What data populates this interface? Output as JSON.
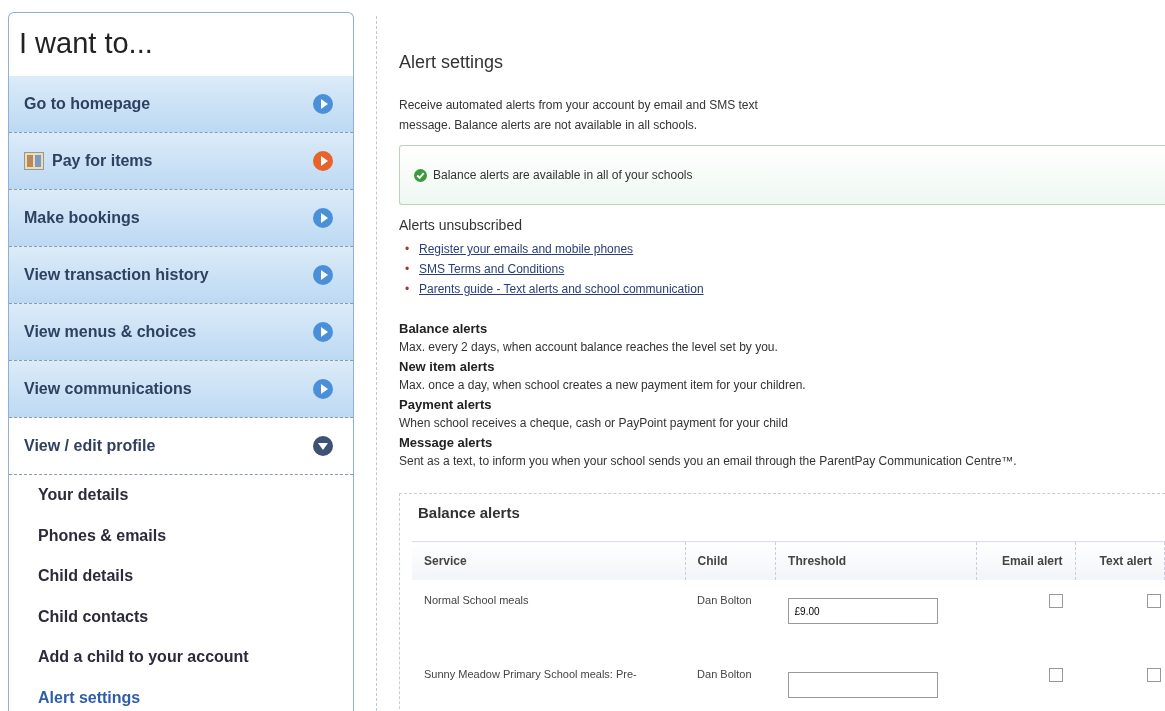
{
  "sidebar": {
    "title": "I want to...",
    "items": [
      {
        "label": "Go to homepage",
        "color": "#4a90d9",
        "has_image": false,
        "expanded": false
      },
      {
        "label": "Pay for items",
        "color": "#e8622c",
        "has_image": true,
        "expanded": false
      },
      {
        "label": "Make bookings",
        "color": "#4a90d9",
        "has_image": false,
        "expanded": false
      },
      {
        "label": "View transaction history",
        "color": "#4a90d9",
        "has_image": false,
        "expanded": false
      },
      {
        "label": "View menus & choices",
        "color": "#4a90d9",
        "has_image": false,
        "expanded": false
      },
      {
        "label": "View communications",
        "color": "#4a90d9",
        "has_image": false,
        "expanded": false
      },
      {
        "label": "View / edit profile",
        "color": "#3d5275",
        "has_image": false,
        "expanded": true,
        "children": [
          {
            "label": "Your details",
            "selected": false
          },
          {
            "label": "Phones & emails",
            "selected": false
          },
          {
            "label": "Child details",
            "selected": false
          },
          {
            "label": "Child contacts",
            "selected": false
          },
          {
            "label": "Add a child to your account",
            "selected": false
          },
          {
            "label": "Alert settings",
            "selected": true
          }
        ]
      }
    ]
  },
  "main": {
    "title": "Alert settings",
    "intro": "Receive automated alerts from your account by email and SMS text message. Balance alerts are not available in all schools.",
    "notice": "Balance alerts are available in all of your schools",
    "unsubscribed_heading": "Alerts unsubscribed",
    "links": [
      {
        "bullet": "•",
        "text": "Register your emails and mobile phones"
      },
      {
        "bullet": "•",
        "text": "SMS Terms and Conditions"
      },
      {
        "bullet": "•",
        "text": "Parents guide - Text alerts and school communication"
      }
    ],
    "alert_types": [
      {
        "name": "Balance alerts",
        "description": "Max. every 2 days, when account balance reaches the level set by you."
      },
      {
        "name": "New item alerts",
        "description": "Max. once a day, when school creates a new payment item for your children."
      },
      {
        "name": "Payment alerts",
        "description": "When school receives a cheque, cash or PayPoint payment for your child"
      },
      {
        "name": "Message alerts",
        "description": "Sent as a text, to inform you when your school sends you an email through the ParentPay Communication Centre™."
      }
    ],
    "balance_alerts": {
      "legend": "Balance alerts",
      "columns": [
        "Service",
        "Child",
        "Threshold",
        "Email alert",
        "Text alert"
      ],
      "rows": [
        {
          "service": "Normal School meals",
          "child": "Dan Bolton",
          "threshold": "£9.00",
          "email_alert": false,
          "text_alert": false
        },
        {
          "service": "Sunny Meadow Primary School meals: Pre-",
          "child": "Dan Bolton",
          "threshold": "",
          "email_alert": false,
          "text_alert": false
        }
      ]
    }
  }
}
